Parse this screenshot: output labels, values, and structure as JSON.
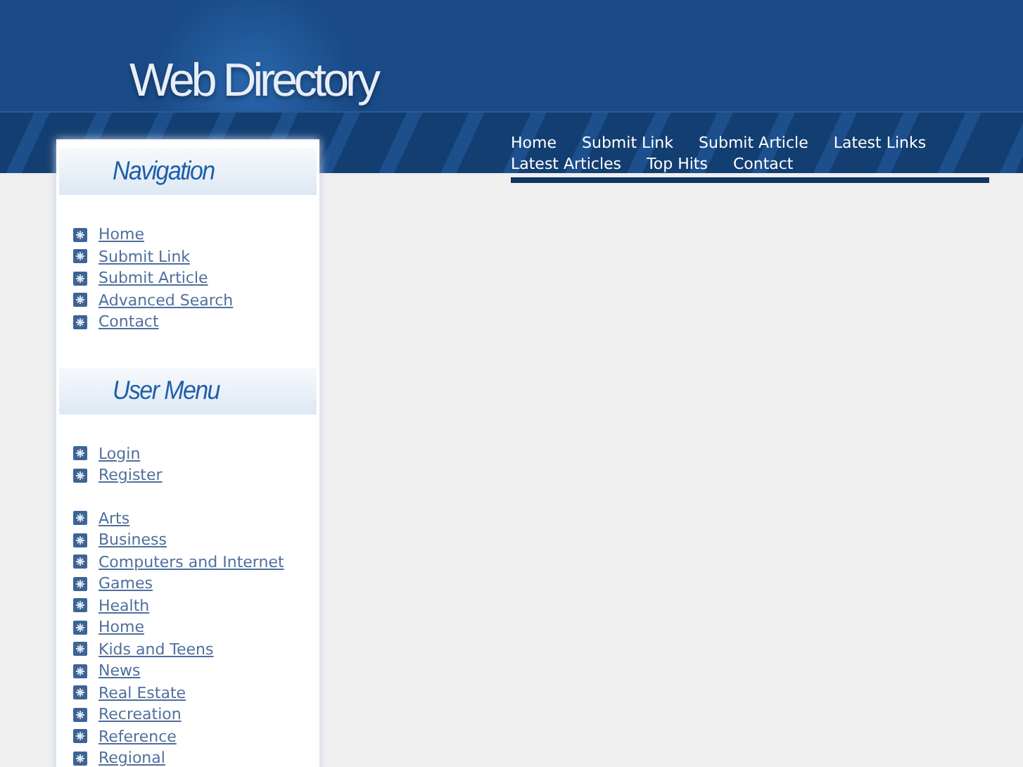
{
  "site": {
    "title": "Web Directory"
  },
  "top_menu": [
    {
      "label": "Home"
    },
    {
      "label": "Submit Link"
    },
    {
      "label": "Submit Article"
    },
    {
      "label": "Latest Links"
    },
    {
      "label": "Latest Articles"
    },
    {
      "label": "Top Hits"
    },
    {
      "label": "Contact"
    }
  ],
  "sidebar": {
    "sections": [
      {
        "title": "Navigation",
        "groups": [
          [
            {
              "label": "Home"
            },
            {
              "label": "Submit Link"
            },
            {
              "label": "Submit Article"
            },
            {
              "label": "Advanced Search"
            },
            {
              "label": "Contact"
            }
          ]
        ]
      },
      {
        "title": "User Menu",
        "groups": [
          [
            {
              "label": "Login"
            },
            {
              "label": "Register"
            }
          ],
          [
            {
              "label": "Arts"
            },
            {
              "label": "Business"
            },
            {
              "label": "Computers and Internet"
            },
            {
              "label": "Games"
            },
            {
              "label": "Health"
            },
            {
              "label": "Home"
            },
            {
              "label": "Kids and Teens"
            },
            {
              "label": "News"
            },
            {
              "label": "Real Estate"
            },
            {
              "label": "Recreation"
            },
            {
              "label": "Reference"
            },
            {
              "label": "Regional"
            }
          ]
        ]
      }
    ]
  }
}
